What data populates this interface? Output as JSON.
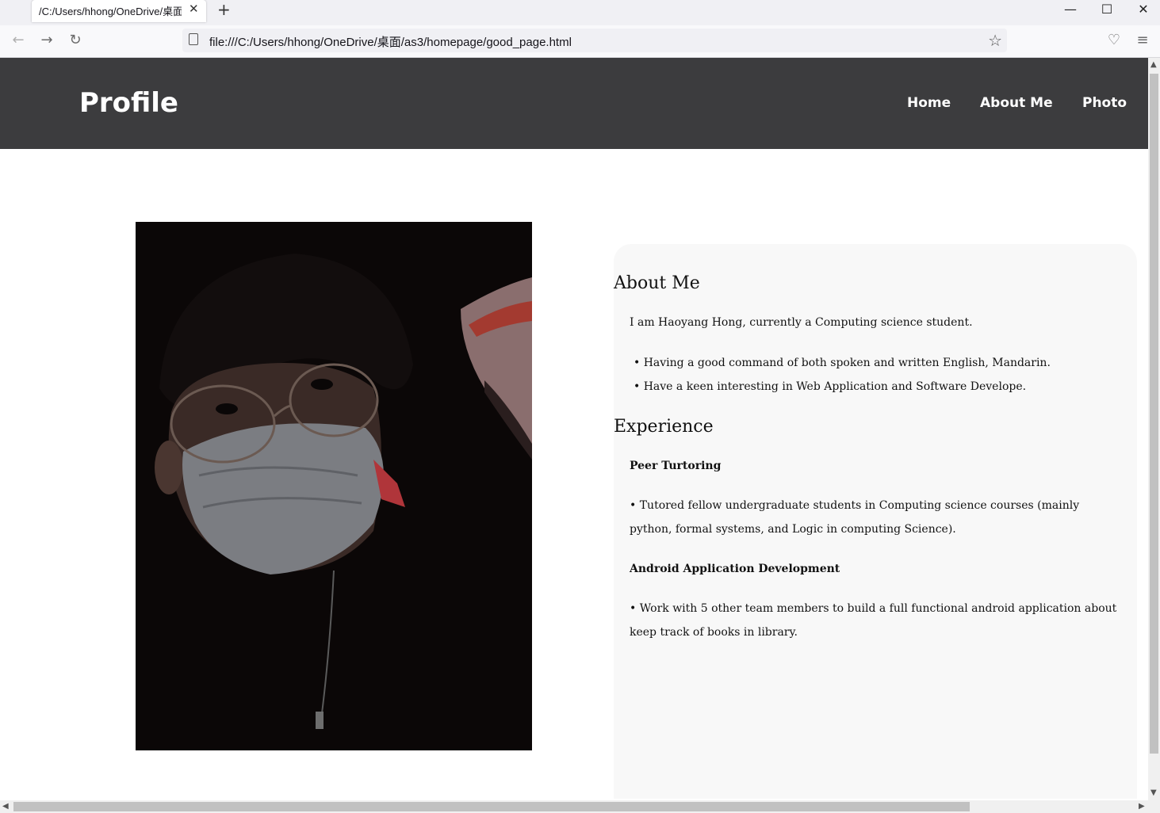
{
  "browser": {
    "tab_title": "/C:/Users/hhong/OneDrive/桌面/",
    "tab_close": "✕",
    "new_tab": "+",
    "url": "file:///C:/Users/hhong/OneDrive/桌面/as3/homepage/good_page.html",
    "icons": [
      "back-arrow-icon",
      "forward-arrow-icon",
      "reload-icon",
      "page-icon",
      "bookmark-star-icon",
      "pocket-icon",
      "menu-icon",
      "minimize-icon",
      "maximize-icon",
      "close-icon"
    ]
  },
  "header": {
    "title": "Profile",
    "nav": [
      "Home",
      "About Me",
      "Photo"
    ],
    "background": "#3c3c3e"
  },
  "about": {
    "heading": "About Me",
    "intro": "I am Haoyang Hong, currently a Computing science student.",
    "bullets": [
      "Having a good command of both spoken and written English, Mandarin.",
      "Have a keen interesting in Web Application and Software Develope."
    ]
  },
  "experience": {
    "heading": "Experience",
    "items": [
      {
        "title": "Peer Turtoring",
        "desc": "• Tutored fellow undergraduate students in Computing science courses (mainly python, formal systems, and Logic in computing Science)."
      },
      {
        "title": "Android Application Development",
        "desc": "• Work with 5 other team members to build a full functional android application about keep track of books in library."
      }
    ]
  },
  "card_background": "#f8f8f8"
}
